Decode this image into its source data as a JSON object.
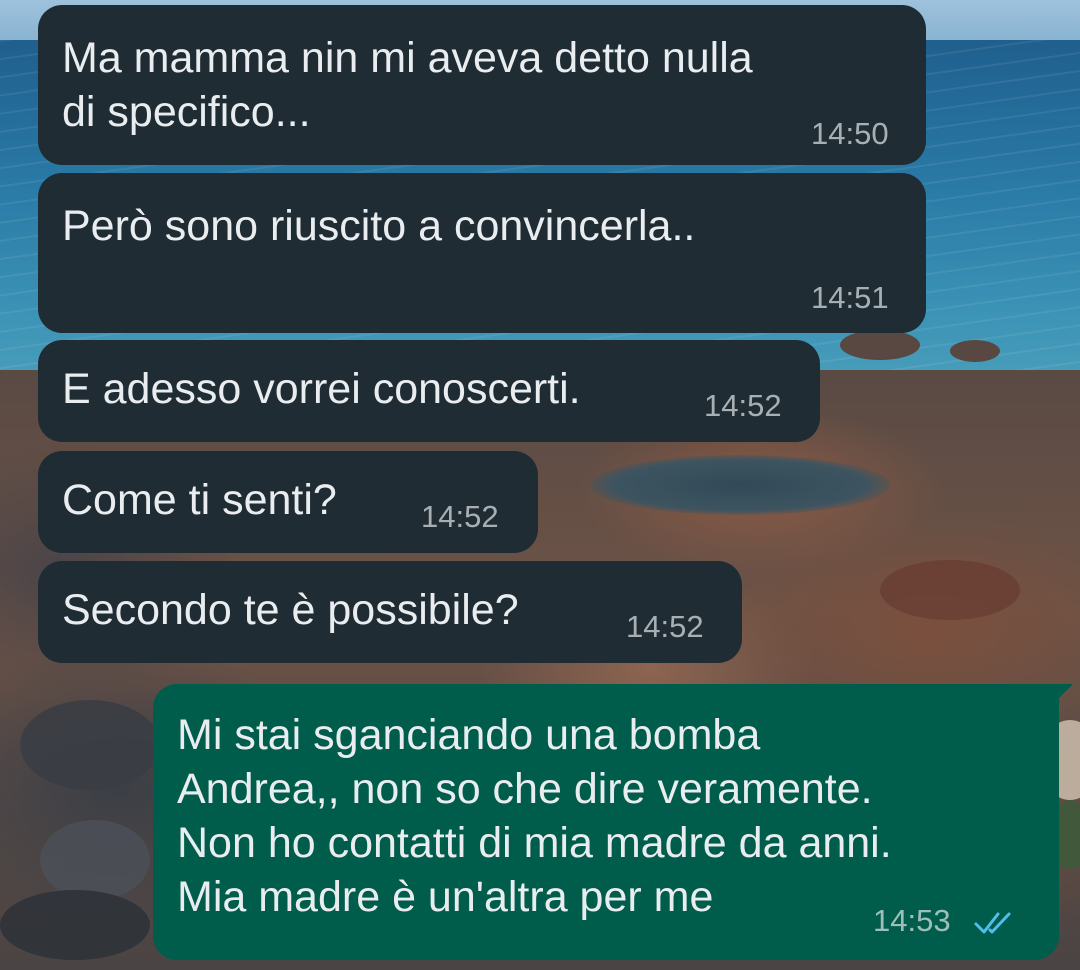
{
  "messages": [
    {
      "direction": "incoming",
      "text": "Ma mamma nin mi aveva detto nulla\ndi specifico...",
      "time": "14:50"
    },
    {
      "direction": "incoming",
      "text": "Però sono riuscito a convincerla..",
      "time": "14:51"
    },
    {
      "direction": "incoming",
      "text": "E adesso vorrei conoscerti.",
      "time": "14:52"
    },
    {
      "direction": "incoming",
      "text": "Come ti senti?",
      "time": "14:52"
    },
    {
      "direction": "incoming",
      "text": "Secondo te è possibile?",
      "time": "14:52"
    },
    {
      "direction": "outgoing",
      "text": "Mi stai sganciando una bomba\nAndrea,, non so che dire veramente.\nNon ho contatti di mia madre da anni.\nMia madre è un'altra per me",
      "time": "14:53",
      "status_icon": "double-check-read-icon"
    }
  ],
  "colors": {
    "incoming_bubble": "#202c33",
    "outgoing_bubble": "#005c4b",
    "read_ticks": "#53bdeb"
  }
}
